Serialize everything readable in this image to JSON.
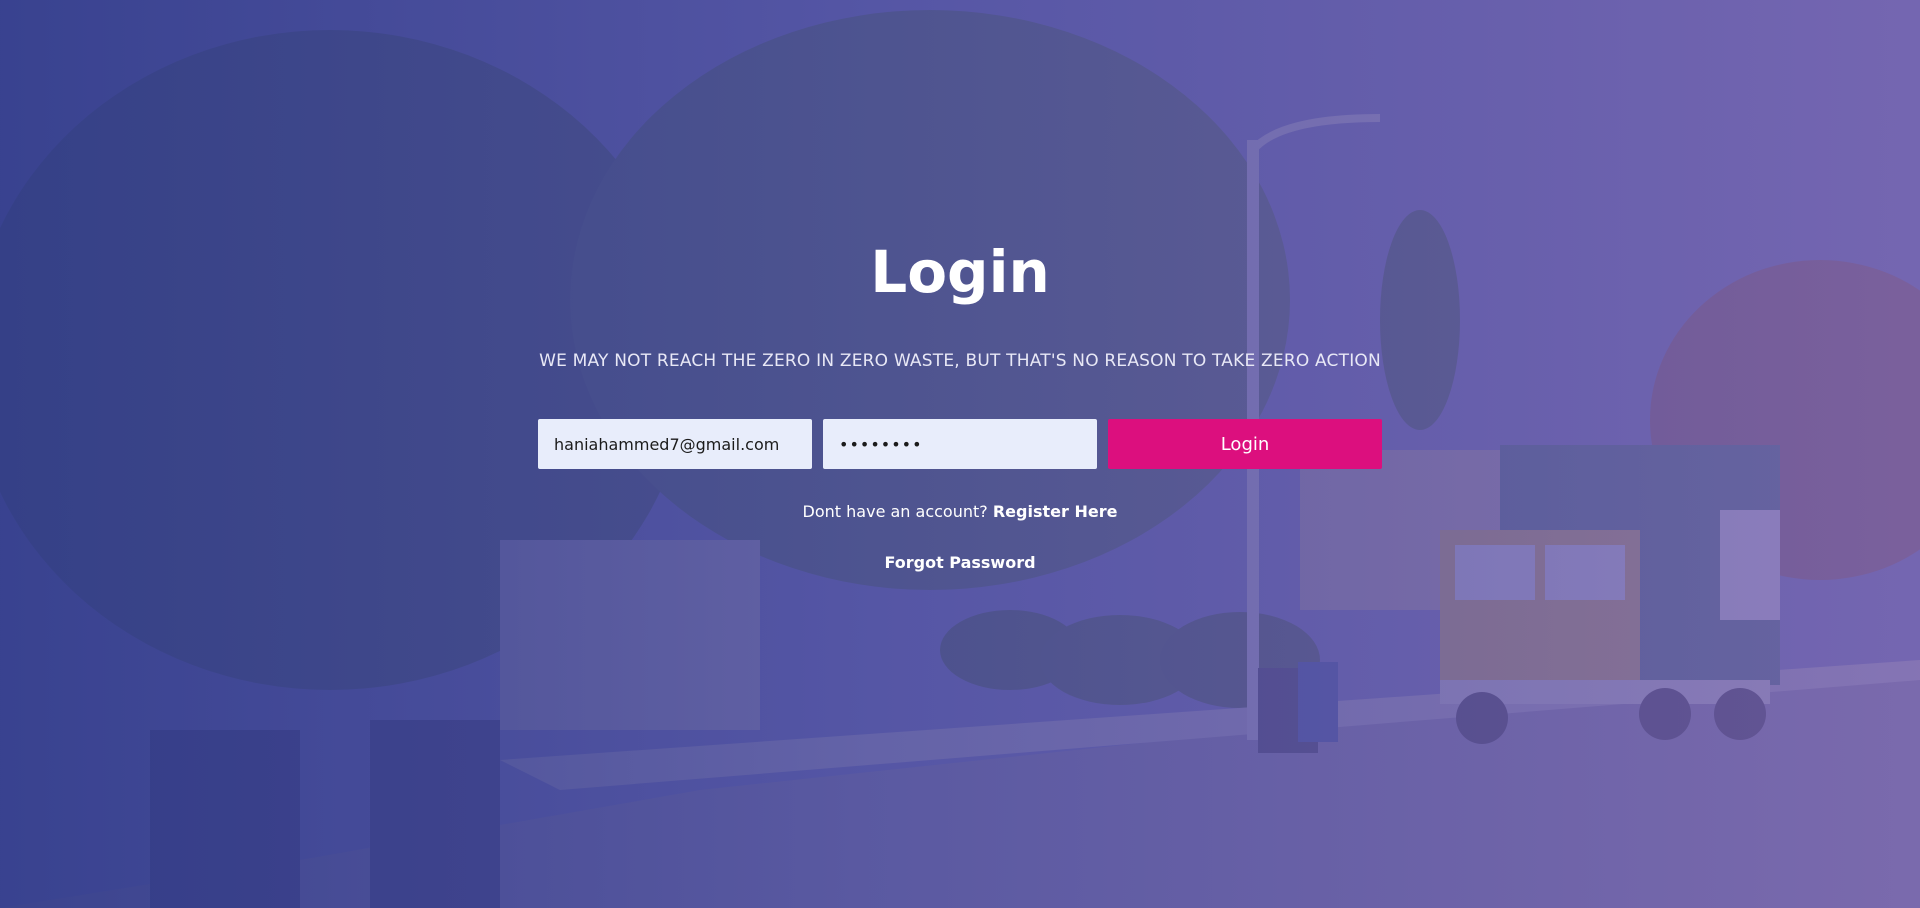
{
  "colors": {
    "overlay_left": "#343e8c",
    "overlay_right": "#7662af",
    "login_button": "#dc0f7e",
    "input_bg": "#e8edfb"
  },
  "header": {
    "title": "Login",
    "tagline": "WE MAY NOT REACH THE ZERO IN ZERO WASTE, BUT THAT'S NO REASON TO TAKE ZERO ACTION"
  },
  "form": {
    "email_value": "haniahammed7@gmail.com",
    "password_value": "••••••••",
    "login_label": "Login"
  },
  "register": {
    "prompt": "Dont have an account? ",
    "link_label": "Register Here"
  },
  "forgot": {
    "label": "Forgot Password"
  },
  "background": {
    "icon": "street-garbage-truck-photo"
  }
}
